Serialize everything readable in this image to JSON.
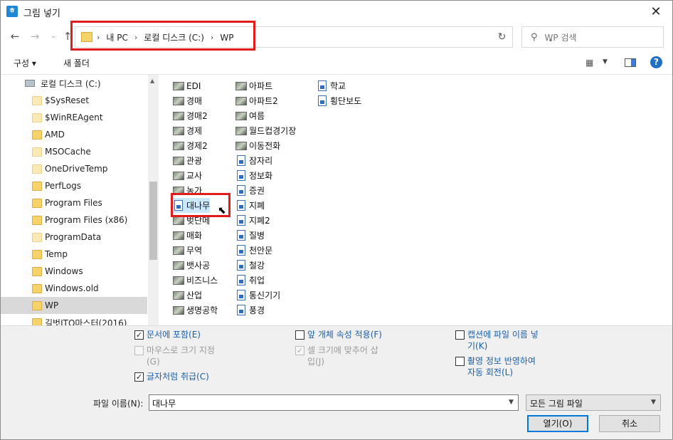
{
  "window": {
    "title": "그림 넣기",
    "app_icon": "hwp-icon"
  },
  "nav": {
    "breadcrumb": [
      "내 PC",
      "로컬 디스크 (C:)",
      "WP"
    ],
    "search_placeholder": "WP 검색"
  },
  "toolbar": {
    "organize": "구성 ▾",
    "new_folder": "새 폴더"
  },
  "tree": {
    "items": [
      "로컬 디스크 (C:)",
      "$SysReset",
      "$WinREAgent",
      "AMD",
      "MSOCache",
      "OneDriveTemp",
      "PerfLogs",
      "Program Files",
      "Program Files (x86)",
      "ProgramData",
      "Temp",
      "Windows",
      "Windows.old",
      "WP",
      "길벗ITQ마스터(2016)"
    ],
    "selected": "WP"
  },
  "files": {
    "col1": [
      "EDI",
      "경매",
      "경매2",
      "경제",
      "경제2",
      "관광",
      "교사",
      "농가",
      "대나무",
      "벚단메",
      "매화",
      "무역",
      "뱃사공",
      "비즈니스",
      "산업",
      "생명공학"
    ],
    "col2": [
      "아파트",
      "아파트2",
      "여름",
      "월드컵경기장",
      "이동전화",
      "잠자리",
      "정보화",
      "증권",
      "지폐",
      "지폐2",
      "질병",
      "천안문",
      "철강",
      "취업",
      "통신기기",
      "풍경"
    ],
    "col3": [
      "학교",
      "횡단보도"
    ],
    "selected": "대나무"
  },
  "options": {
    "embed": "문서에 포함(E)",
    "mouse_size": "마우스로 크기 지정",
    "mouse_size_key": "(G)",
    "as_char": "글자처럼 취급(C)",
    "front_props": "앞 개체 속성 적용(F)",
    "fit_cell_1": "셀 크기에 맞추어 삽",
    "fit_cell_2": "입(J)",
    "caption_1": "캡션에 파일 이름 넣",
    "caption_2": "기(K)",
    "rotate_1": "촬영 정보 반영하여",
    "rotate_2": "자동 회전(L)"
  },
  "footer": {
    "filename_label": "파일 이름(N):",
    "filename_value": "대나무",
    "filetype": "모든 그림 파일",
    "open": "열기(O)",
    "cancel": "취소"
  },
  "colors": {
    "highlight": "#e01c1c",
    "link_text": "#1b5faa",
    "selection": "#cce8ff"
  }
}
